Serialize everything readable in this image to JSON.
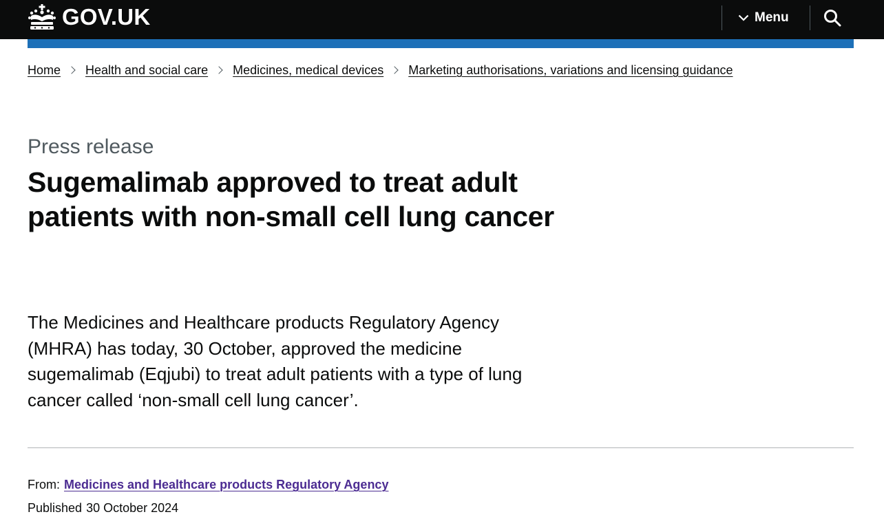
{
  "header": {
    "logo_text": "GOV.UK",
    "logo_icon": "crown-icon",
    "menu_label": "Menu",
    "menu_icon": "chevron-down-icon",
    "search_icon": "search-icon",
    "background": "#0b0c0c",
    "accent_bar": "#1d70b8"
  },
  "breadcrumbs": [
    "Home",
    "Health and social care",
    "Medicines, medical devices",
    "Marketing authorisations, variations and licensing guidance"
  ],
  "page": {
    "caption": "Press release",
    "title": "Sugemalimab approved to treat adult patients with non-small cell lung cancer",
    "lead": "The Medicines and Healthcare products Regulatory Agency (MHRA) has today, 30 October, approved the medicine sugemalimab (Eqjubi) to treat adult patients with a type of lung cancer called ‘non-small cell lung cancer’."
  },
  "metadata": {
    "from_label": "From:",
    "from_org": "Medicines and Healthcare products Regulatory Agency",
    "published_label": "Published",
    "published_date": "30 October 2024",
    "link_color": "#4c2c92"
  }
}
